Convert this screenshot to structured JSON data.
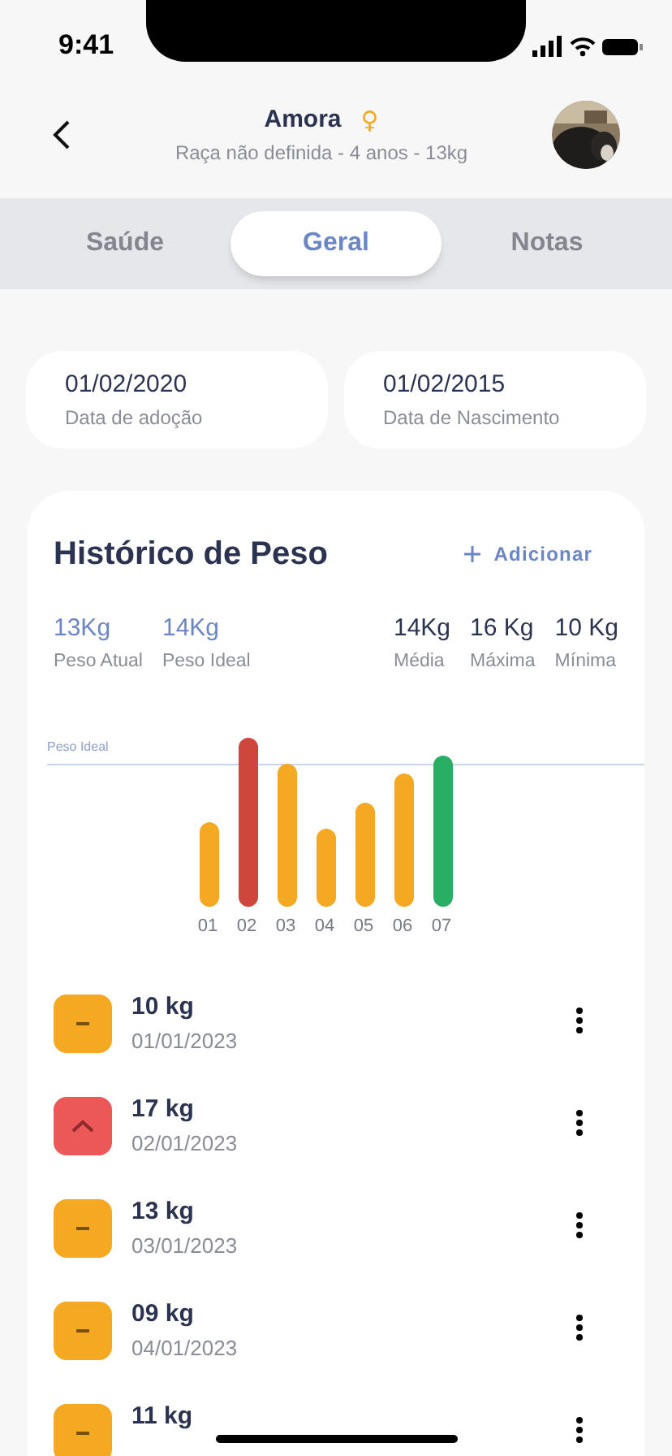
{
  "status_bar": {
    "time": "9:41"
  },
  "header": {
    "name": "Amora",
    "gender_symbol": "♀",
    "subtitle": "Raça não definida - 4 anos - 13kg"
  },
  "tabs": [
    {
      "label": "Saúde",
      "selected": false
    },
    {
      "label": "Geral",
      "selected": true
    },
    {
      "label": "Notas",
      "selected": false
    }
  ],
  "date_cards": [
    {
      "value": "01/02/2020",
      "label": "Data de adoção"
    },
    {
      "value": "01/02/2015",
      "label": "Data de Nascimento"
    }
  ],
  "weight_history": {
    "title": "Histórico de Peso",
    "add_button": "Adicionar",
    "stats": [
      {
        "value": "13Kg",
        "label": "Peso Atual",
        "kind": "highlight"
      },
      {
        "value": "14Kg",
        "label": "Peso Ideal",
        "kind": "highlight"
      },
      {
        "value": "14Kg",
        "label": "Média",
        "kind": "plain"
      },
      {
        "value": "16 Kg",
        "label": "Máxima",
        "kind": "plain"
      },
      {
        "value": "10 Kg",
        "label": "Mínima",
        "kind": "plain"
      }
    ],
    "chart": {
      "ideal_line_label": "Peso Ideal",
      "bars": [
        {
          "label": "01",
          "color": "#f5a821"
        },
        {
          "label": "02",
          "color": "#cf463d"
        },
        {
          "label": "03",
          "color": "#f5a821"
        },
        {
          "label": "04",
          "color": "#f5a821"
        },
        {
          "label": "05",
          "color": "#f5a821"
        },
        {
          "label": "06",
          "color": "#f5a821"
        },
        {
          "label": "07",
          "color": "#28af63"
        }
      ]
    },
    "entries": [
      {
        "weight": "10 kg",
        "date": "01/01/2023",
        "kind": "stable"
      },
      {
        "weight": "17 kg",
        "date": "02/01/2023",
        "kind": "up"
      },
      {
        "weight": "13 kg",
        "date": "03/01/2023",
        "kind": "stable"
      },
      {
        "weight": "09 kg",
        "date": "04/01/2023",
        "kind": "stable"
      },
      {
        "weight": "11 kg",
        "kind": "stable"
      }
    ]
  }
}
